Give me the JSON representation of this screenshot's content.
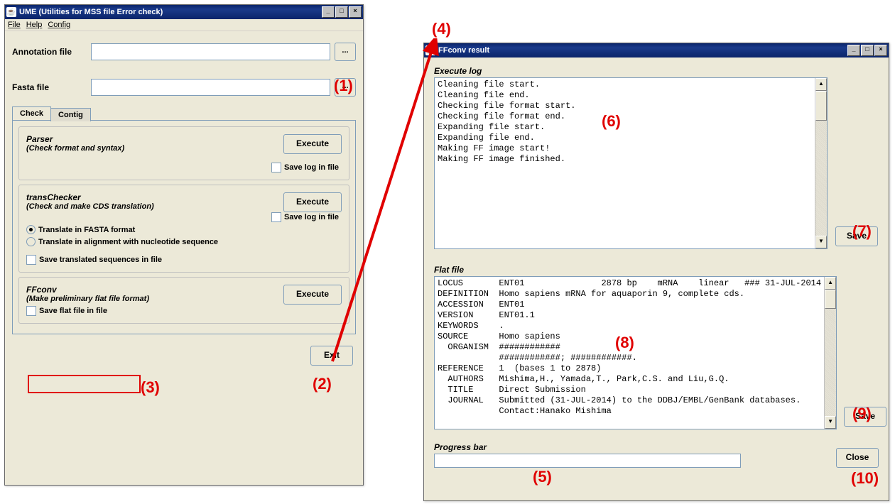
{
  "win1": {
    "title": "UME (Utilities for MSS file Error check)",
    "menu": {
      "file": "File",
      "help": "Help",
      "config": "Config"
    },
    "annotation_label": "Annotation file",
    "fasta_label": "Fasta  file",
    "browse": "...",
    "tabs": {
      "check": "Check",
      "contig": "Contig"
    },
    "parser": {
      "title": "Parser",
      "subtitle": "(Check format and syntax)",
      "execute": "Execute",
      "save_log": "Save log in file"
    },
    "transchecker": {
      "title": "transChecker",
      "subtitle": "(Check and make CDS translation)",
      "execute": "Execute",
      "save_log": "Save log in file",
      "radio1": "Translate in FASTA format",
      "radio2": "Translate in alignment with nucleotide sequence",
      "save_trans": "Save translated sequences in file"
    },
    "ffconv": {
      "title": "FFconv",
      "subtitle": "(Make preliminary flat file format)",
      "execute": "Execute",
      "save_ff": "Save flat file in file"
    },
    "exit": "Exit"
  },
  "win2": {
    "title": "FFconv result",
    "log_title": "Execute log",
    "log_text": "Cleaning file start.\nCleaning file end.\nChecking file format start.\nChecking file format end.\nExpanding file start.\nExpanding file end.\nMaking FF image start!\nMaking FF image finished.",
    "save1": "Save",
    "ff_title": "Flat file",
    "ff_text": "LOCUS       ENT01               2878 bp    mRNA    linear   ### 31-JUL-2014\nDEFINITION  Homo sapiens mRNA for aquaporin 9, complete cds.\nACCESSION   ENT01\nVERSION     ENT01.1\nKEYWORDS    .\nSOURCE      Homo sapiens\n  ORGANISM  ############\n            ############; ############.\nREFERENCE   1  (bases 1 to 2878)\n  AUTHORS   Mishima,H., Yamada,T., Park,C.S. and Liu,G.Q.\n  TITLE     Direct Submission\n  JOURNAL   Submitted (31-JUL-2014) to the DDBJ/EMBL/GenBank databases.\n            Contact:Hanako Mishima",
    "save2": "Save",
    "progress_title": "Progress bar",
    "close": "Close"
  },
  "annotations": {
    "a1": "(1)",
    "a2": "(2)",
    "a3": "(3)",
    "a4": "(4)",
    "a5": "(5)",
    "a6": "(6)",
    "a7": "(7)",
    "a8": "(8)",
    "a9": "(9)",
    "a10": "(10)"
  }
}
